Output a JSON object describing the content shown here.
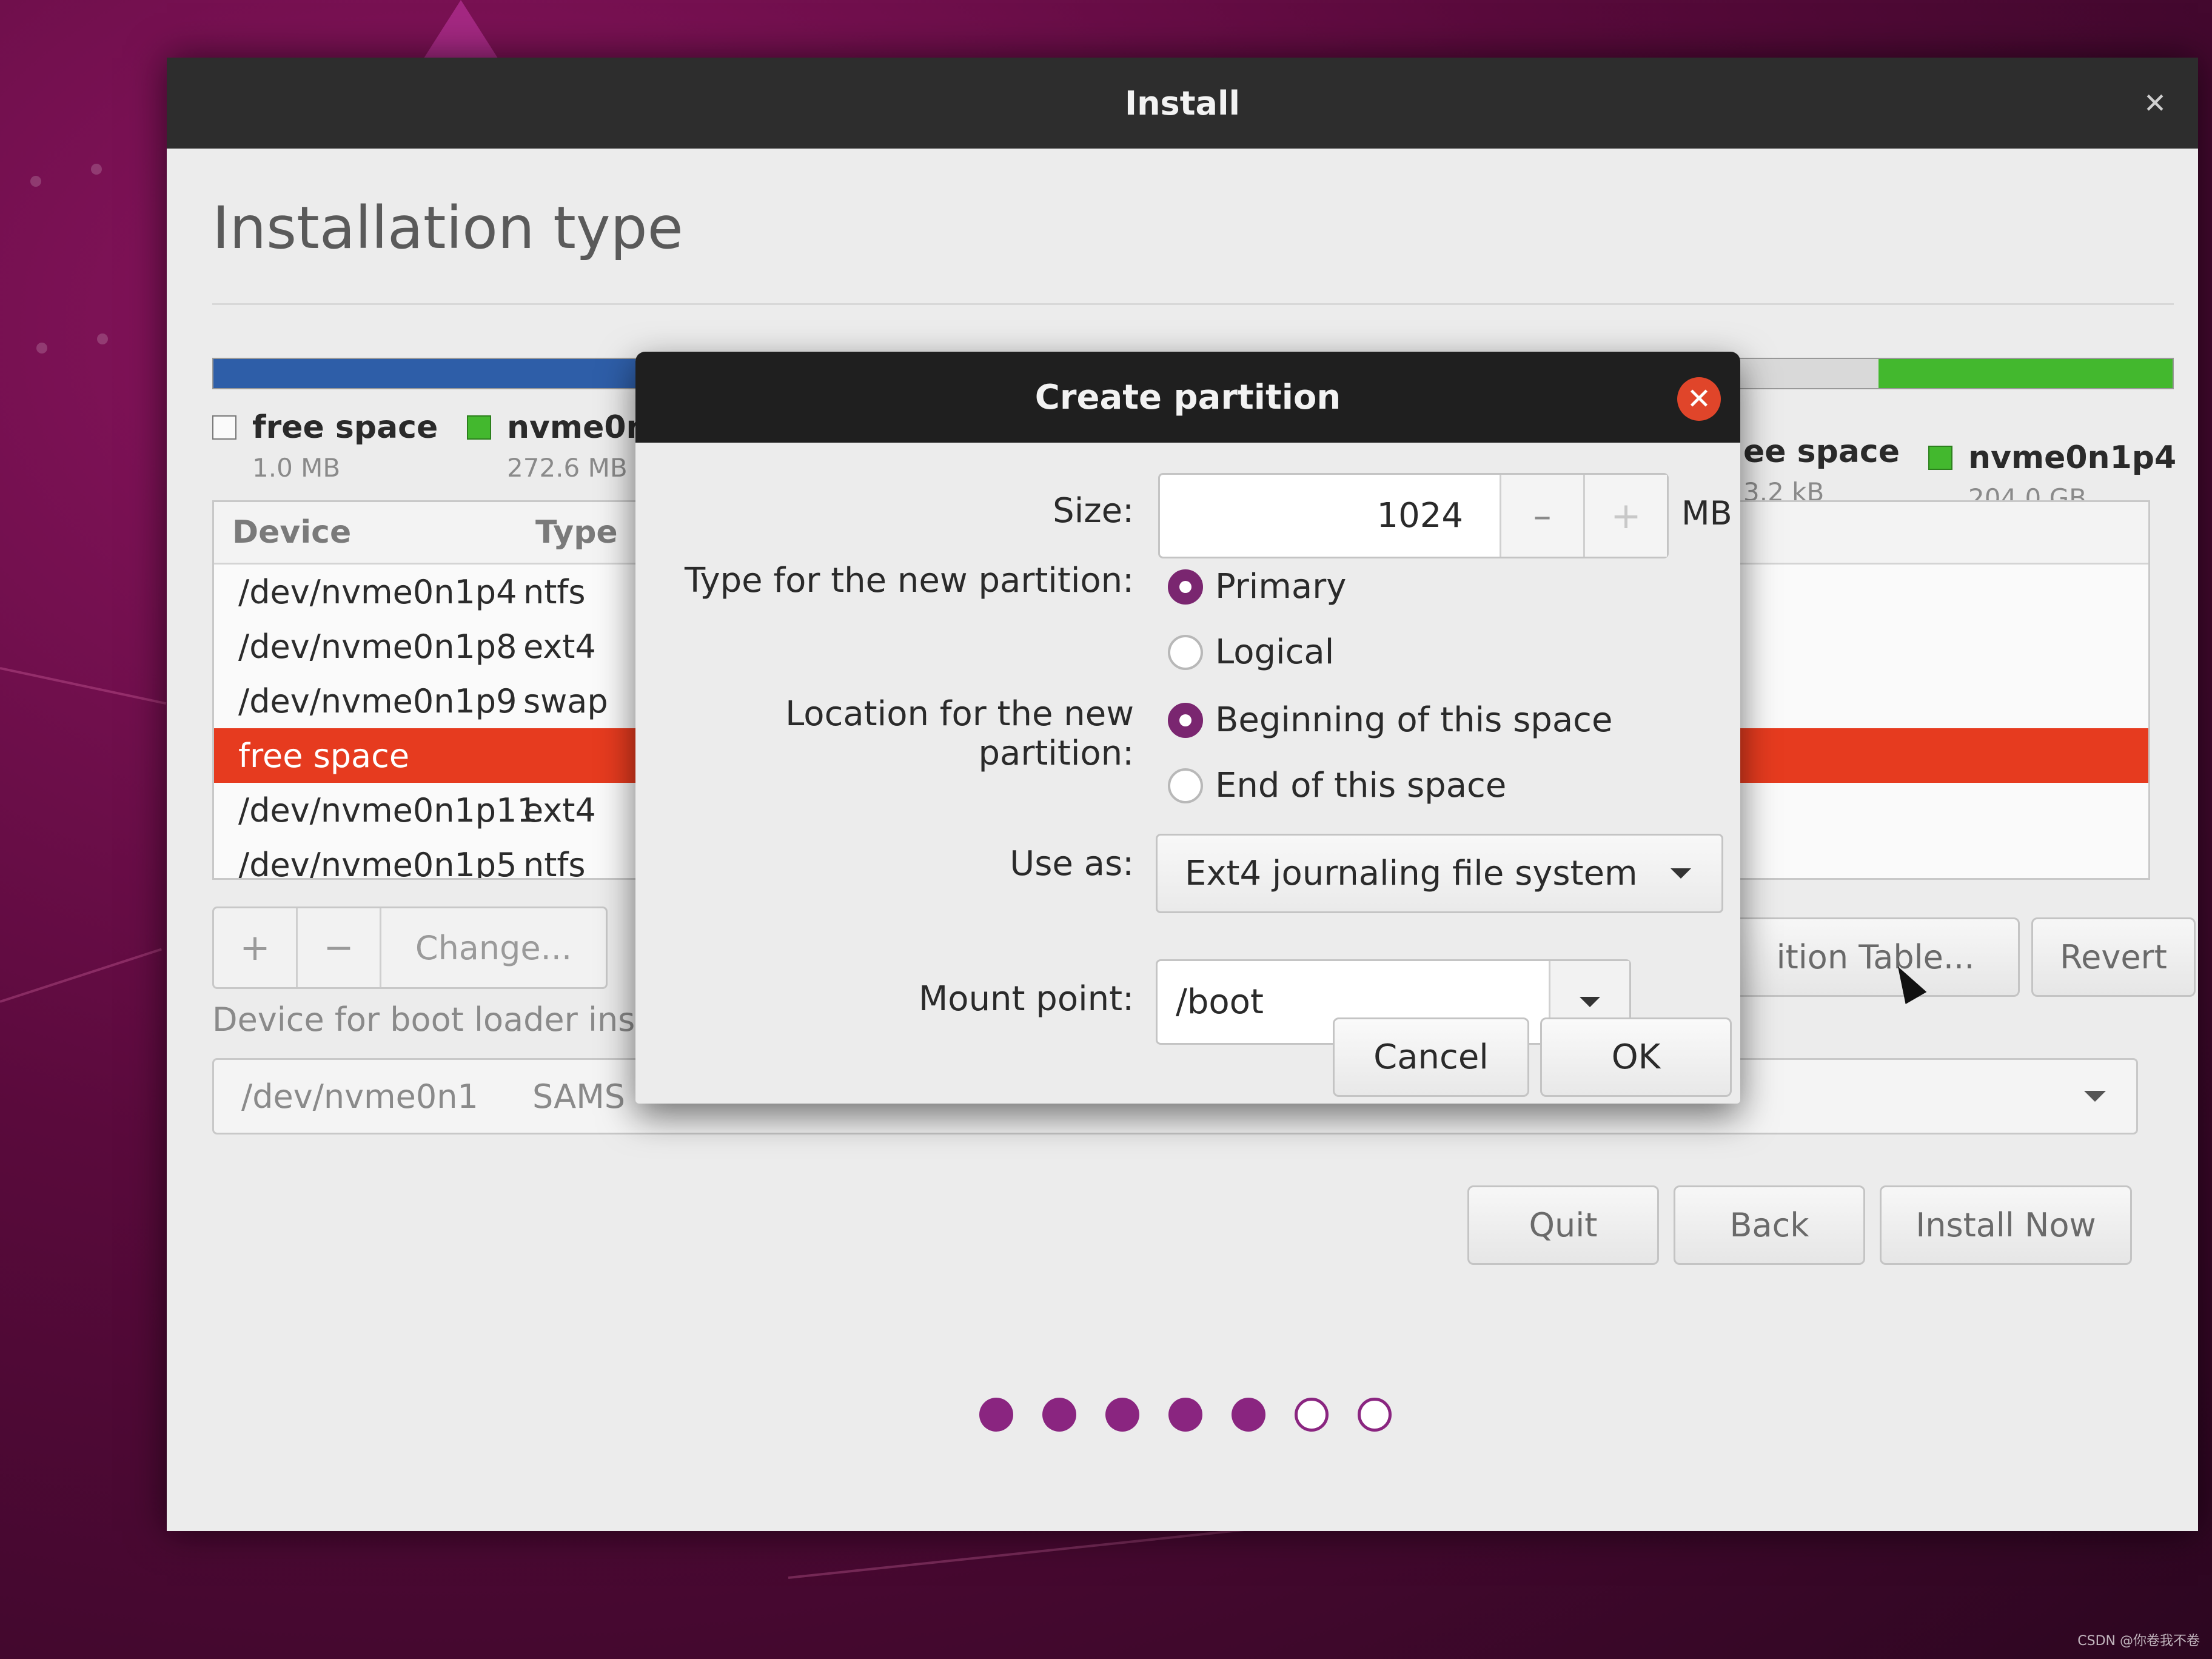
{
  "window": {
    "title": "Install",
    "close_icon": "close-icon",
    "page_title": "Installation type"
  },
  "legend": [
    {
      "name": "free space",
      "size": "1.0 MB",
      "swatch": "empty"
    },
    {
      "name": "nvme0n",
      "size": "272.6 MB",
      "swatch": "green"
    },
    {
      "name": "ee space",
      "size": "3.2 kB",
      "swatch": "empty"
    },
    {
      "name": "nvme0n1p4",
      "size": "204.0 GB",
      "swatch": "green"
    }
  ],
  "table": {
    "headers": {
      "device": "Device",
      "type": "Type"
    },
    "rows": [
      {
        "device": "/dev/nvme0n1p4",
        "type": "ntfs"
      },
      {
        "device": "/dev/nvme0n1p8",
        "type": "ext4"
      },
      {
        "device": "/dev/nvme0n1p9",
        "type": "swap"
      },
      {
        "device": "free space",
        "type": ""
      },
      {
        "device": "/dev/nvme0n1p11",
        "type": "ext4"
      },
      {
        "device": "/dev/nvme0n1p5",
        "type": "ntfs"
      }
    ],
    "selected_row": 3
  },
  "toolbar": {
    "add_label": "+",
    "remove_label": "−",
    "change_label": "Change...",
    "new_table_label": "ition Table...",
    "revert_label": "Revert"
  },
  "boot": {
    "label": "Device for boot loader inst",
    "device": "/dev/nvme0n1",
    "model": "SAMS"
  },
  "nav": {
    "quit_label": "Quit",
    "back_label": "Back",
    "install_label": "Install Now"
  },
  "progress": {
    "total": 7,
    "done": 5
  },
  "dialog": {
    "title": "Create partition",
    "size_label": "Size:",
    "size_value": "1024",
    "size_unit": "MB",
    "decrement": "–",
    "increment": "+",
    "type_label": "Type for the new partition:",
    "type_primary": "Primary",
    "type_logical": "Logical",
    "location_label": "Location for the new partition:",
    "location_beginning": "Beginning of this space",
    "location_end": "End of this space",
    "use_as_label": "Use as:",
    "use_as_value": "Ext4 journaling file system",
    "mount_label": "Mount point:",
    "mount_value": "/boot",
    "cancel_label": "Cancel",
    "ok_label": "OK",
    "close_glyph": "✕"
  },
  "colors": {
    "accent": "#7a2670",
    "selection": "#e63b1f",
    "partition_blue": "#2e5ea8",
    "partition_green": "#43b82e"
  },
  "watermark": "CSDN @你卷我不卷"
}
